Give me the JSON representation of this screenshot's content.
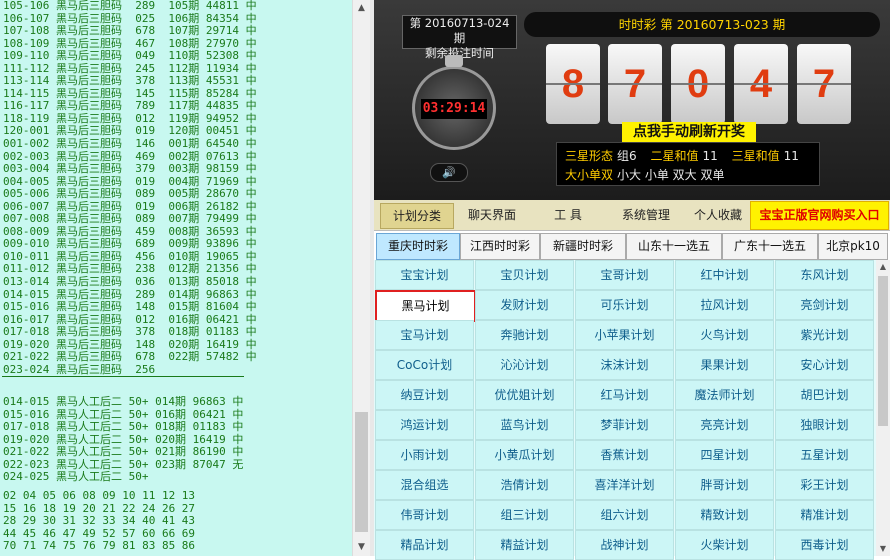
{
  "left_panel": {
    "block1": "105-106 黑马后三胆码  289  105期 44811 中\n106-107 黑马后三胆码  025  106期 84354 中\n107-108 黑马后三胆码  678  107期 29714 中\n108-109 黑马后三胆码  467  108期 27970 中\n109-110 黑马后三胆码  049  110期 52308 中\n111-112 黑马后三胆码  245  112期 11934 中\n113-114 黑马后三胆码  378  113期 45531 中\n114-115 黑马后三胆码  145  115期 85284 中\n116-117 黑马后三胆码  789  117期 44835 中\n118-119 黑马后三胆码  012  119期 94952 中\n120-001 黑马后三胆码  019  120期 00451 中\n001-002 黑马后三胆码  146  001期 64540 中\n002-003 黑马后三胆码  469  002期 07613 中\n003-004 黑马后三胆码  379  003期 98159 中\n004-005 黑马后三胆码  019  004期 71969 中\n005-006 黑马后三胆码  089  005期 28670 中\n006-007 黑马后三胆码  019  006期 26182 中\n007-008 黑马后三胆码  089  007期 79499 中\n008-009 黑马后三胆码  459  008期 36593 中\n009-010 黑马后三胆码  689  009期 93896 中\n010-011 黑马后三胆码  456  010期 19065 中\n011-012 黑马后三胆码  238  012期 21356 中\n013-014 黑马后三胆码  036  013期 85018 中\n014-015 黑马后三胆码  289  014期 96863 中\n015-016 黑马后三胆码  148  015期 81604 中\n016-017 黑马后三胆码  012  016期 06421 中\n017-018 黑马后三胆码  378  018期 01183 中\n019-020 黑马后三胆码  148  020期 16419 中\n021-022 黑马后三胆码  678  022期 57482 中\n023-024 黑马后三胆码  256",
    "block2": "014-015 黑马人工后二 50+ 014期 96863 中\n015-016 黑马人工后二 50+ 016期 06421 中\n017-018 黑马人工后二 50+ 018期 01183 中\n019-020 黑马人工后二 50+ 020期 16419 中\n021-022 黑马人工后二 50+ 021期 86190 中\n022-023 黑马人工后二 50+ 023期 87047 无\n024-025 黑马人工后二 50+",
    "block3": "02 04 05 06 08 09 10 11 12 13\n15 16 18 19 20 21 22 24 26 27\n28 29 30 31 32 33 34 40 41 43\n44 45 46 47 49 52 57 60 66 69\n70 71 74 75 76 79 81 83 85 86"
  },
  "scroll": {
    "up_icon": "▲",
    "down_icon": "▼"
  },
  "lottery": {
    "next_period": "第 20160713-024 期",
    "countdown_label": "剩余投注时间",
    "countdown": "03:29:14",
    "speaker_icon": "🔊",
    "draw_title": "时时彩   第 20160713-023 期",
    "digits": [
      "8",
      "7",
      "0",
      "4",
      "7"
    ],
    "refresh_label": "点我手动刷新开奖",
    "stats": {
      "r1": [
        {
          "label": "三星形态",
          "value": "组6"
        },
        {
          "label": "二星和值",
          "value": "11"
        },
        {
          "label": "三星和值",
          "value": "11"
        }
      ],
      "r2": [
        {
          "label": "大小单双",
          "value": "小大 小单 双大 双单"
        }
      ]
    }
  },
  "menu": {
    "tabs": [
      "计划分类",
      "聊天界面",
      "工 具",
      "系统管理",
      "个人收藏"
    ],
    "buy": "宝宝正版官网购买入口"
  },
  "lottery_tabs": [
    "重庆时时彩",
    "江西时时彩",
    "新疆时时彩",
    "山东十一选五",
    "广东十一选五",
    "北京pk10"
  ],
  "plans": [
    "宝宝计划",
    "宝贝计划",
    "宝哥计划",
    "红中计划",
    "东风计划",
    "黑马计划",
    "发财计划",
    "可乐计划",
    "拉风计划",
    "亮剑计划",
    "宝马计划",
    "奔驰计划",
    "小苹果计划",
    "火鸟计划",
    "紫光计划",
    "CoCo计划",
    "沁沁计划",
    "沫沫计划",
    "果果计划",
    "安心计划",
    "纳豆计划",
    "优优姐计划",
    "红马计划",
    "魔法师计划",
    "胡巴计划",
    "鸿运计划",
    "蓝鸟计划",
    "梦菲计划",
    "亮亮计划",
    "独眼计划",
    "小雨计划",
    "小黄瓜计划",
    "香蕉计划",
    "四星计划",
    "五星计划",
    "混合组选",
    "浩倩计划",
    "喜洋洋计划",
    "胖哥计划",
    "彩王计划",
    "伟哥计划",
    "组三计划",
    "组六计划",
    "精致计划",
    "精准计划",
    "精品计划",
    "精益计划",
    "战神计划",
    "火柴计划",
    "西毒计划"
  ],
  "selected_plan": "黑马计划",
  "colors": {
    "digit": "#e03c10",
    "highlight": "#fff200",
    "left_text": "#1a7a1a",
    "plan_text": "#0f5e8c",
    "selection": "#e02020"
  }
}
